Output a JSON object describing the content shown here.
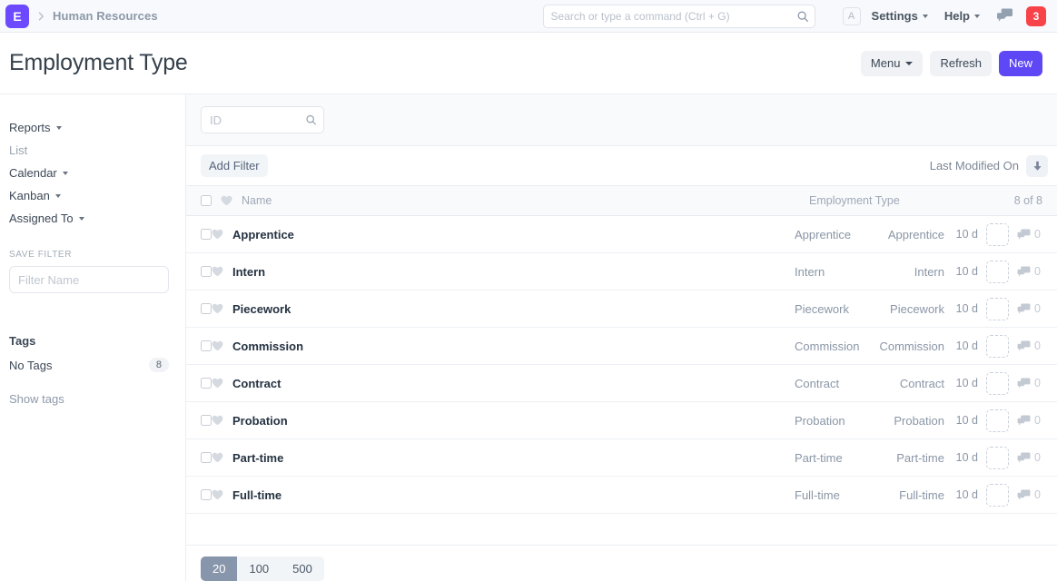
{
  "navbar": {
    "logo_letter": "E",
    "breadcrumb": "Human Resources",
    "search": {
      "placeholder": "Search or type a command (Ctrl + G)",
      "value": ""
    },
    "avatar_letter": "A",
    "settings_label": "Settings",
    "help_label": "Help",
    "notification_count": "3",
    "icons": {
      "search": "search-icon",
      "chat": "chat-icon",
      "chevron_right": "chevron-right-icon"
    }
  },
  "page": {
    "title": "Employment Type",
    "actions": {
      "menu": "Menu",
      "refresh": "Refresh",
      "new": "New"
    }
  },
  "sidebar": {
    "items": [
      {
        "label": "Reports",
        "has_caret": true,
        "muted": false
      },
      {
        "label": "List",
        "has_caret": false,
        "muted": true
      },
      {
        "label": "Calendar",
        "has_caret": true,
        "muted": false
      },
      {
        "label": "Kanban",
        "has_caret": true,
        "muted": false
      },
      {
        "label": "Assigned To",
        "has_caret": true,
        "muted": false
      }
    ],
    "save_filter_label": "SAVE FILTER",
    "filter_name_placeholder": "Filter Name",
    "filter_name_value": "",
    "tags_heading": "Tags",
    "no_tags_label": "No Tags",
    "no_tags_count": "8",
    "show_tags_label": "Show tags"
  },
  "list": {
    "id_placeholder": "ID",
    "id_value": "",
    "add_filter_label": "Add Filter",
    "sort_label": "Last Modified On",
    "sort_direction": "desc",
    "columns": {
      "name": "Name",
      "employment_type": "Employment Type",
      "count": "8 of 8"
    },
    "rows": [
      {
        "name": "Apprentice",
        "type": "Apprentice",
        "type_right": "Apprentice",
        "age": "10 d",
        "comments": "0"
      },
      {
        "name": "Intern",
        "type": "Intern",
        "type_right": "Intern",
        "age": "10 d",
        "comments": "0"
      },
      {
        "name": "Piecework",
        "type": "Piecework",
        "type_right": "Piecework",
        "age": "10 d",
        "comments": "0"
      },
      {
        "name": "Commission",
        "type": "Commission",
        "type_right": "Commission",
        "age": "10 d",
        "comments": "0"
      },
      {
        "name": "Contract",
        "type": "Contract",
        "type_right": "Contract",
        "age": "10 d",
        "comments": "0"
      },
      {
        "name": "Probation",
        "type": "Probation",
        "type_right": "Probation",
        "age": "10 d",
        "comments": "0"
      },
      {
        "name": "Part-time",
        "type": "Part-time",
        "type_right": "Part-time",
        "age": "10 d",
        "comments": "0"
      },
      {
        "name": "Full-time",
        "type": "Full-time",
        "type_right": "Full-time",
        "age": "10 d",
        "comments": "0"
      }
    ],
    "page_sizes": [
      {
        "label": "20",
        "active": true
      },
      {
        "label": "100",
        "active": false
      },
      {
        "label": "500",
        "active": false
      }
    ]
  },
  "colors": {
    "brand_purple": "#6d4aff",
    "primary_button": "#5e47f5",
    "notification_red": "#f8434a",
    "page_title": "#36414c",
    "muted_text": "#8a96a6",
    "pager_active": "#8896ab"
  }
}
